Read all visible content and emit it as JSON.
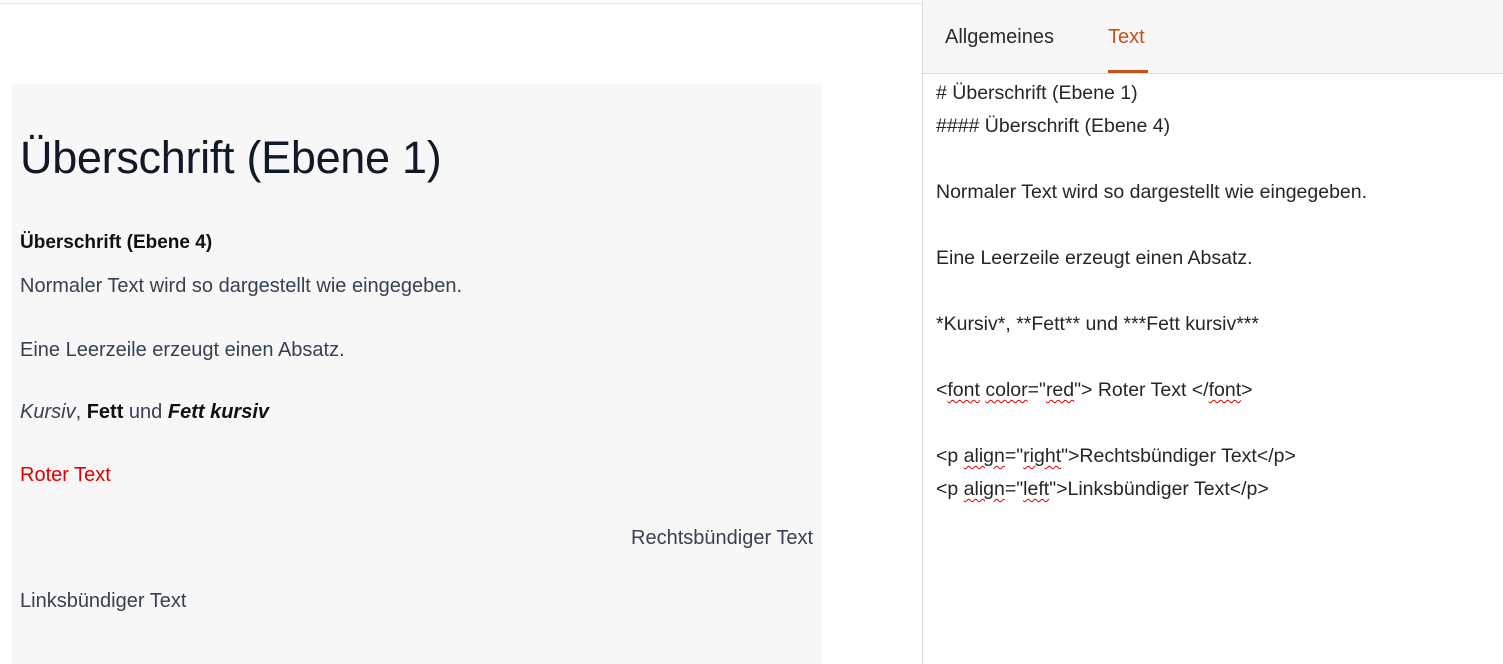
{
  "preview": {
    "h1": "Überschrift (Ebene 1)",
    "h4": "Überschrift (Ebene 4)",
    "para1": "Normaler Text wird so dargestellt wie eingegeben.",
    "para2": "Eine Leerzeile erzeugt einen Absatz.",
    "italic": "Kursiv",
    "comma": ", ",
    "bold": "Fett",
    "und": " und ",
    "bold_italic": "Fett kursiv",
    "red_text": "Roter Text",
    "red_color": "#e00000",
    "right_text": "Rechtsbündiger Text",
    "left_text": "Linksbündiger Text"
  },
  "tabs": {
    "general": "Allgemeines",
    "text": "Text",
    "active": "text",
    "accent_color": "#c0531a"
  },
  "editor": {
    "line1": "# Überschrift (Ebene 1)",
    "line2": "#### Überschrift (Ebene 4)",
    "line3": "Normaler Text wird so dargestellt wie eingegeben.",
    "line4": "Eine Leerzeile erzeugt einen Absatz.",
    "line5": "*Kursiv*, **Fett** und ***Fett kursiv***",
    "line6": {
      "a": "<",
      "b": "font",
      "c": " ",
      "d": "color",
      "e": "=\"",
      "f": "red",
      "g": "\"> Roter Text </",
      "h": "font",
      "i": ">"
    },
    "line7": {
      "a": "<p ",
      "b": "align",
      "c": "=\"",
      "d": "right",
      "e": "\">Rechtsbündiger Text</p>"
    },
    "line8": {
      "a": "<p ",
      "b": "align",
      "c": "=\"",
      "d": "left",
      "e": "\">Linksbündiger Text</p>"
    }
  }
}
